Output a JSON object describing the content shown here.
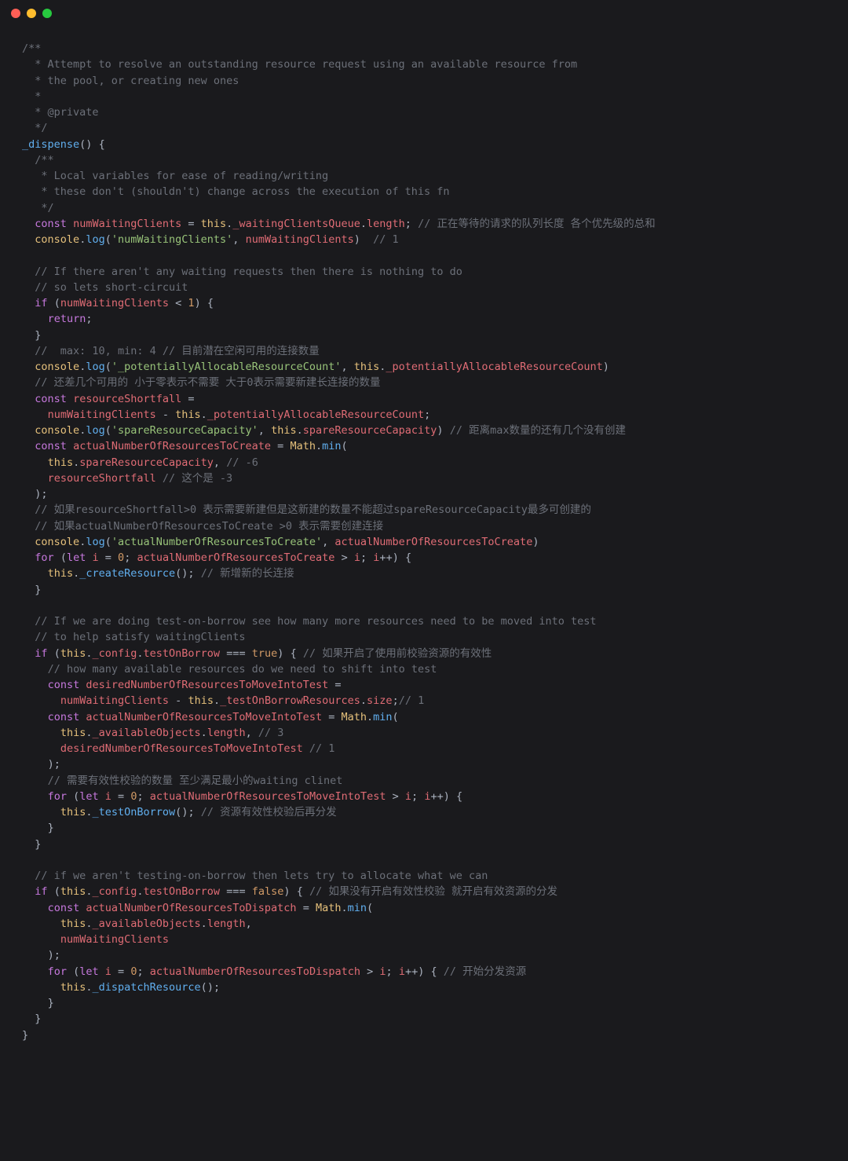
{
  "titlebar": {
    "close": "close",
    "min": "minimize",
    "max": "maximize"
  },
  "code": {
    "lines": [
      "/**",
      "  * Attempt to resolve an outstanding resource request using an available resource from",
      "  * the pool, or creating new ones",
      "  *",
      "  * @private",
      "  */",
      "_dispense() {",
      "  /**",
      "   * Local variables for ease of reading/writing",
      "   * these don't (shouldn't) change across the execution of this fn",
      "   */",
      "  const numWaitingClients = this._waitingClientsQueue.length; // 正在等待的请求的队列长度 各个优先级的总和",
      "  console.log('numWaitingClients', numWaitingClients)  // 1",
      "",
      "  // If there aren't any waiting requests then there is nothing to do",
      "  // so lets short-circuit",
      "  if (numWaitingClients < 1) {",
      "    return;",
      "  }",
      "  //  max: 10, min: 4 // 目前潜在空闲可用的连接数量",
      "  console.log('_potentiallyAllocableResourceCount', this._potentiallyAllocableResourceCount)",
      "  // 还差几个可用的 小于零表示不需要 大于0表示需要新建长连接的数量",
      "  const resourceShortfall =",
      "    numWaitingClients - this._potentiallyAllocableResourceCount;",
      "  console.log('spareResourceCapacity', this.spareResourceCapacity) // 距离max数量的还有几个没有创建",
      "  const actualNumberOfResourcesToCreate = Math.min(",
      "    this.spareResourceCapacity, // -6",
      "    resourceShortfall // 这个是 -3",
      "  );",
      "  // 如果resourceShortfall>0 表示需要新建但是这新建的数量不能超过spareResourceCapacity最多可创建的",
      "  // 如果actualNumberOfResourcesToCreate >0 表示需要创建连接",
      "  console.log('actualNumberOfResourcesToCreate', actualNumberOfResourcesToCreate)",
      "  for (let i = 0; actualNumberOfResourcesToCreate > i; i++) {",
      "    this._createResource(); // 新增新的长连接",
      "  }",
      "",
      "  // If we are doing test-on-borrow see how many more resources need to be moved into test",
      "  // to help satisfy waitingClients",
      "  if (this._config.testOnBorrow === true) { // 如果开启了使用前校验资源的有效性",
      "    // how many available resources do we need to shift into test",
      "    const desiredNumberOfResourcesToMoveIntoTest =",
      "      numWaitingClients - this._testOnBorrowResources.size;// 1",
      "    const actualNumberOfResourcesToMoveIntoTest = Math.min(",
      "      this._availableObjects.length, // 3",
      "      desiredNumberOfResourcesToMoveIntoTest // 1",
      "    );",
      "    // 需要有效性校验的数量 至少满足最小的waiting clinet",
      "    for (let i = 0; actualNumberOfResourcesToMoveIntoTest > i; i++) {",
      "      this._testOnBorrow(); // 资源有效性校验后再分发",
      "    }",
      "  }",
      "",
      "  // if we aren't testing-on-borrow then lets try to allocate what we can",
      "  if (this._config.testOnBorrow === false) { // 如果没有开启有效性校验 就开启有效资源的分发",
      "    const actualNumberOfResourcesToDispatch = Math.min(",
      "      this._availableObjects.length,",
      "      numWaitingClients",
      "    );",
      "    for (let i = 0; actualNumberOfResourcesToDispatch > i; i++) { // 开始分发资源",
      "      this._dispatchResource();",
      "    }",
      "  }",
      "}"
    ]
  }
}
